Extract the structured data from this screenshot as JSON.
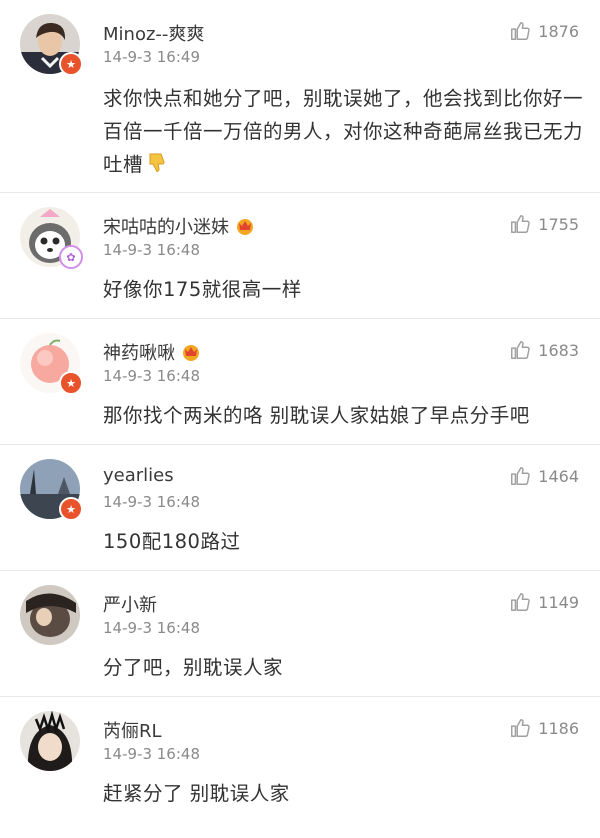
{
  "comments": [
    {
      "name": "Minoz--爽爽",
      "time": "14-9-3 16:49",
      "likes": "1876",
      "text": "求你快点和她分了吧，别耽误她了，他会找到比你好一百倍一千倍一万倍的男人，对你这种奇葩屌丝我已无力吐槽",
      "emoji": "thumbs-down-emoji",
      "badge": "verified"
    },
    {
      "name": "宋咕咕的小迷妹",
      "time": "14-9-3 16:48",
      "likes": "1755",
      "text": "好像你175就很高一样",
      "badge": "vip"
    },
    {
      "name": "神药啾啾",
      "time": "14-9-3 16:48",
      "likes": "1683",
      "text": "那你找个两米的咯 别耽误人家姑娘了早点分手吧",
      "badge": "verified"
    },
    {
      "name": "yearlies",
      "time": "14-9-3 16:48",
      "likes": "1464",
      "text": "150配180路过",
      "badge": "verified"
    },
    {
      "name": "严小新",
      "time": "14-9-3 16:48",
      "likes": "1149",
      "text": "分了吧，别耽误人家",
      "badge": "none"
    },
    {
      "name": "芮俪RL",
      "time": "14-9-3 16:48",
      "likes": "1186",
      "text": "赶紧分了 别耽误人家",
      "badge": "none"
    }
  ],
  "colors": {
    "name": "#3a3a3a",
    "meta": "#8a8a8a",
    "badge_red": "#e8532c",
    "divider": "#e8e8e8"
  }
}
